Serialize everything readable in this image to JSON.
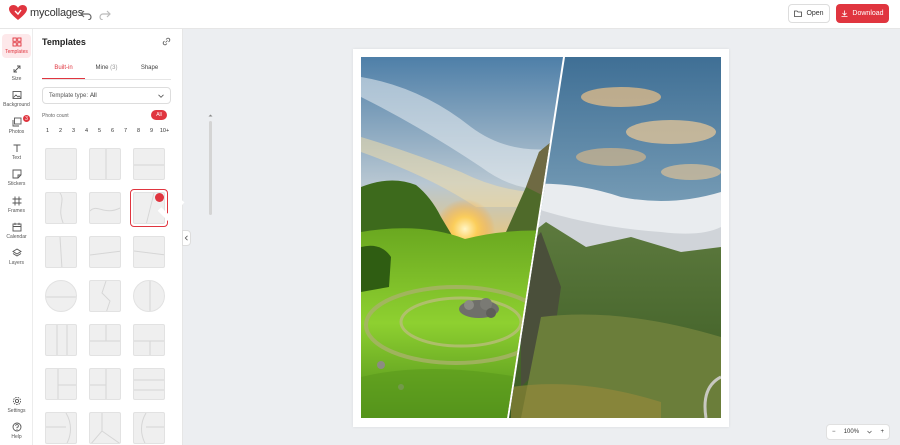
{
  "app": {
    "logo_text": "mycollages",
    "brand_color": "#e0353f"
  },
  "toolbar": {
    "open_label": "Open",
    "download_label": "Download"
  },
  "rail": {
    "items": [
      {
        "label": "Templates",
        "icon": "grid-icon"
      },
      {
        "label": "Size",
        "icon": "resize-icon"
      },
      {
        "label": "Background",
        "icon": "image-icon"
      },
      {
        "label": "Photos",
        "icon": "photos-icon",
        "badge": "3"
      },
      {
        "label": "Text",
        "icon": "text-icon"
      },
      {
        "label": "Stickers",
        "icon": "sticker-icon"
      },
      {
        "label": "Frames",
        "icon": "frame-icon"
      },
      {
        "label": "Calendar",
        "icon": "calendar-icon"
      },
      {
        "label": "Layers",
        "icon": "layers-icon"
      }
    ],
    "bottom": [
      {
        "label": "Settings",
        "icon": "gear-icon"
      },
      {
        "label": "Help",
        "icon": "help-icon"
      }
    ]
  },
  "panel": {
    "title": "Templates",
    "tabs": [
      {
        "label": "Built-in"
      },
      {
        "label": "Mine",
        "count": "(3)"
      },
      {
        "label": "Shape"
      }
    ],
    "template_type_label": "Template type:",
    "template_type_value": "All",
    "photo_count_label": "Photo count",
    "photo_count_all": "All",
    "counts": [
      "1",
      "2",
      "3",
      "4",
      "5",
      "6",
      "7",
      "8",
      "9",
      "10+"
    ]
  },
  "zoom": {
    "value": "100%"
  }
}
